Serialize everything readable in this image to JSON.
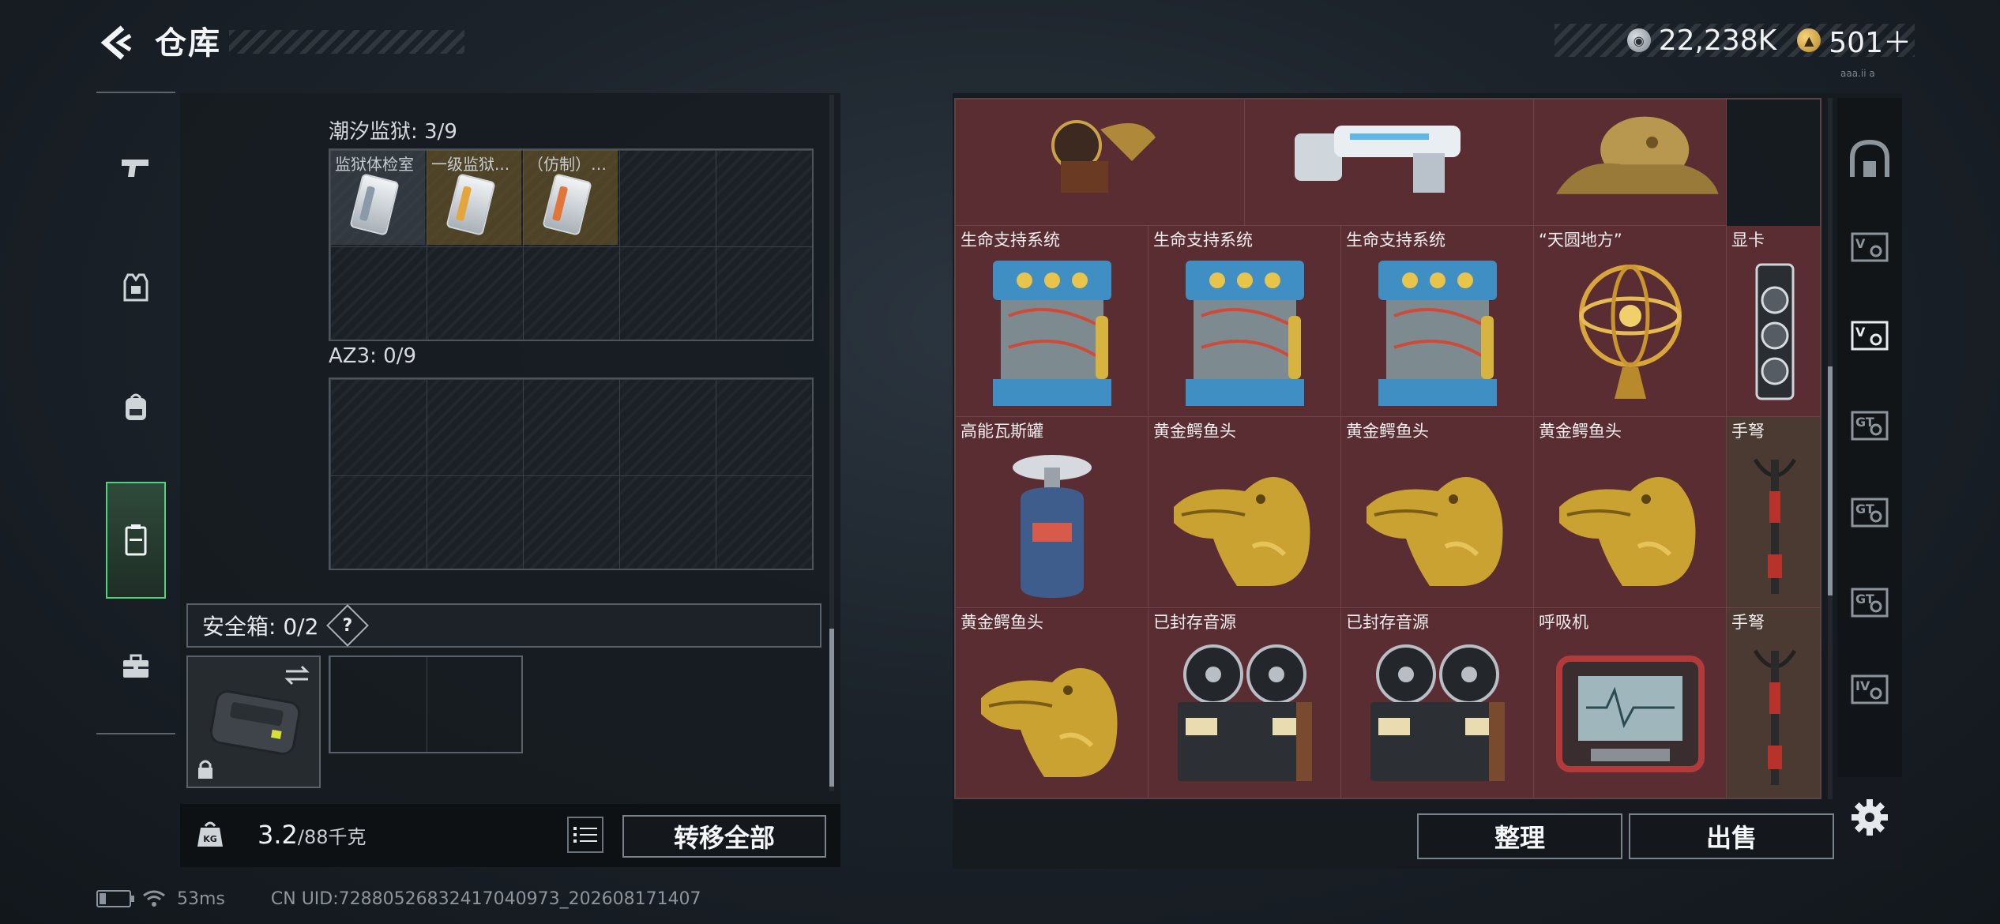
{
  "header": {
    "title": "仓库",
    "currency": [
      {
        "icon": "silver-coin-icon",
        "value": "22,238K"
      },
      {
        "icon": "gold-coin-icon",
        "value": "501＋"
      }
    ],
    "small_text": "aaa.ii a"
  },
  "left_nav": {
    "items": [
      {
        "icon": "pistol-icon"
      },
      {
        "icon": "vest-icon"
      },
      {
        "icon": "backpack-icon"
      },
      {
        "icon": "container-icon",
        "active": true
      },
      {
        "icon": "toolbox-icon"
      }
    ]
  },
  "storage": {
    "sections": [
      {
        "label": "潮汐监狱: 3/9",
        "items": [
          {
            "name": "监狱体检室",
            "stripe": "#8a9aa8"
          },
          {
            "name": "一级监狱...",
            "stripe": "#e4a63a"
          },
          {
            "name": "（仿制）二...",
            "stripe": "#e0763a"
          }
        ]
      },
      {
        "label": "AZ3: 0/9",
        "items": []
      }
    ],
    "safe_box": {
      "label": "安全箱: 0/2",
      "help": "?"
    },
    "weight": {
      "current": "3.2",
      "max": "/88千克",
      "kg_icon_label": "KG"
    },
    "transfer_all": "转移全部"
  },
  "inventory": {
    "rows": [
      [
        {
          "name": "",
          "art": "gramophone-icon"
        },
        {
          "name": "",
          "art": "robot-arm-icon"
        },
        {
          "name": "",
          "art": "bust-icon"
        }
      ],
      [
        {
          "name": "生命支持系统",
          "art": "life-support-icon"
        },
        {
          "name": "生命支持系统",
          "art": "life-support-icon"
        },
        {
          "name": "生命支持系统",
          "art": "life-support-icon"
        },
        {
          "name": "“天圆地方”",
          "art": "armillary-icon"
        },
        {
          "name": "显卡",
          "art": "gpu-icon"
        }
      ],
      [
        {
          "name": "高能瓦斯罐",
          "art": "gas-tank-icon"
        },
        {
          "name": "黄金鳄鱼头",
          "art": "gold-croc-icon"
        },
        {
          "name": "黄金鳄鱼头",
          "art": "gold-croc-icon"
        },
        {
          "name": "黄金鳄鱼头",
          "art": "gold-croc-icon"
        },
        {
          "name": "手弩",
          "art": "crossbow-icon"
        }
      ],
      [
        {
          "name": "黄金鳄鱼头",
          "art": "gold-croc-icon"
        },
        {
          "name": "已封存音源",
          "art": "reel-recorder-icon"
        },
        {
          "name": "已封存音源",
          "art": "reel-recorder-icon"
        },
        {
          "name": "呼吸机",
          "art": "ventilator-icon"
        },
        {
          "name": "手弩",
          "art": "crossbow-icon"
        }
      ]
    ],
    "sort_button": "整理",
    "sell_button": "出售"
  },
  "right_nav": {
    "items": [
      {
        "label": "",
        "icon": "home-arch-icon"
      },
      {
        "label": "V",
        "icon": "tab-v-icon"
      },
      {
        "label": "V",
        "icon": "tab-v-active-icon"
      },
      {
        "label": "GT",
        "icon": "tab-gt1-icon"
      },
      {
        "label": "GT",
        "icon": "tab-gt2-icon"
      },
      {
        "label": "GT",
        "icon": "tab-gt3-icon"
      },
      {
        "label": "IV",
        "icon": "tab-iv-icon"
      }
    ]
  },
  "status": {
    "ping": "53ms",
    "uid": "CN UID:7288052683241704097​3_202608171407"
  }
}
